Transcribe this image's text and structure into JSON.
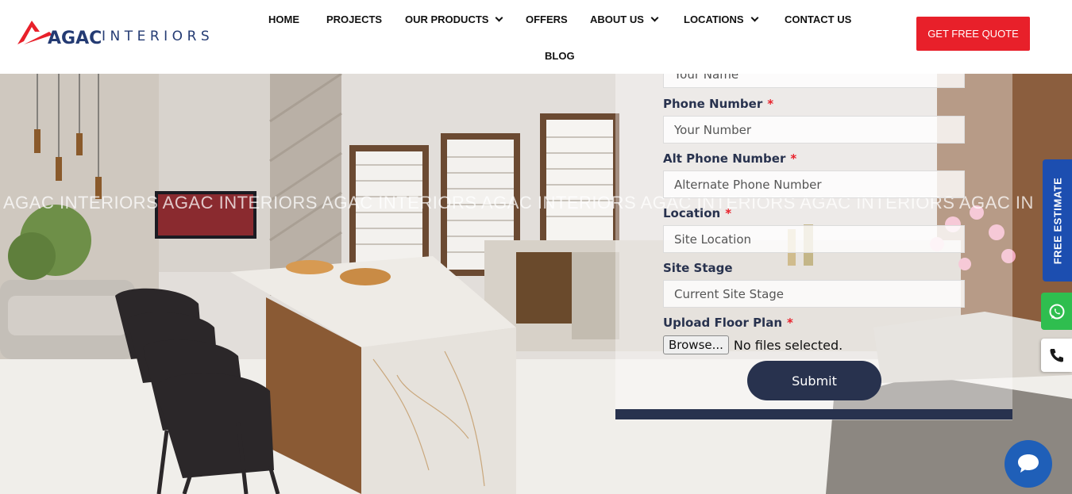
{
  "brand": {
    "logo_mark": "AGAC",
    "logo_text": "INTERIORS"
  },
  "nav": {
    "items": [
      {
        "label": "HOME"
      },
      {
        "label": "PROJECTS"
      },
      {
        "label": "OUR PRODUCTS"
      },
      {
        "label": "OFFERS"
      },
      {
        "label": "ABOUT US"
      },
      {
        "label": "LOCATIONS"
      },
      {
        "label": "CONTACT US"
      },
      {
        "label": "BLOG"
      }
    ],
    "cta_label": "GET FREE QUOTE"
  },
  "hero": {
    "watermark": "AGAC INTERIORS AGAC INTERIORS AGAC INTERIORS AGAC INTERIORS AGAC INTERIORS AGAC INTERIORS AGAC IN"
  },
  "form": {
    "name_placeholder": "Your Name",
    "phone_label": "Phone Number",
    "phone_placeholder": "Your Number",
    "alt_phone_label": "Alt Phone Number",
    "alt_phone_placeholder": "Alternate Phone Number",
    "location_label": "Location",
    "location_placeholder": "Site Location",
    "site_stage_label": "Site Stage",
    "site_stage_placeholder": "Current Site Stage",
    "floor_plan_label": "Upload Floor Plan",
    "browse_label": "Browse...",
    "file_status": "No files selected.",
    "required_mark": "*",
    "submit_label": "Submit"
  },
  "side": {
    "estimate_label": "FREE ESTIMATE",
    "whatsapp_icon": "whatsapp-icon",
    "phone_icon": "phone-icon"
  },
  "colors": {
    "accent_red": "#e8202a",
    "navy": "#28324e",
    "estimate_blue": "#1c4eb0",
    "whatsapp_green": "#2fbe4f",
    "chat_blue": "#1f5fb8"
  }
}
